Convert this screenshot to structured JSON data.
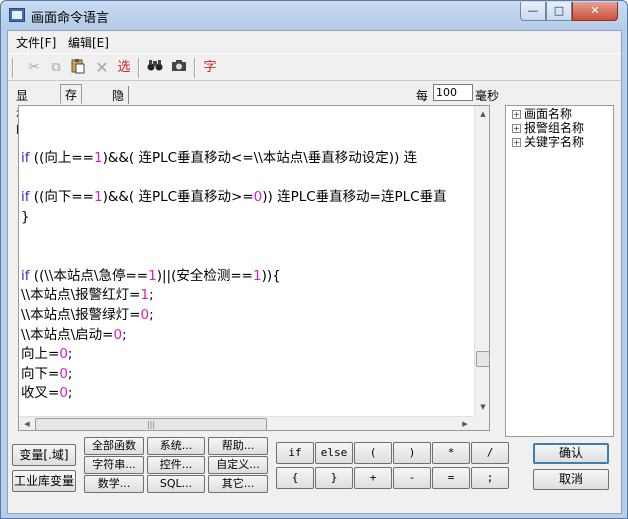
{
  "window": {
    "title": "画面命令语言",
    "min": "—",
    "max": "□",
    "close": "✕"
  },
  "menu": [
    "文件[F]",
    "编辑[E]"
  ],
  "toolbar": {
    "select_label": "选",
    "font_label": "字"
  },
  "tabs": [
    "显示时",
    "存在时",
    "隐含时"
  ],
  "period": {
    "prefix": "每",
    "value": "100",
    "unit": "毫秒"
  },
  "code_lines": [
    {
      "segs": [
        {
          "t": ""
        }
      ]
    },
    {
      "segs": [
        {
          "t": ""
        }
      ]
    },
    {
      "segs": [
        {
          "t": "if",
          "c": "kw"
        },
        {
          "t": " ((向上=="
        },
        {
          "t": "1",
          "c": "num"
        },
        {
          "t": ")&&( 连PLC垂直移动<=\\\\本站点\\垂直移动设定)) 连"
        }
      ]
    },
    {
      "segs": [
        {
          "t": ""
        }
      ]
    },
    {
      "segs": [
        {
          "t": "if",
          "c": "kw"
        },
        {
          "t": " ((向下=="
        },
        {
          "t": "1",
          "c": "num"
        },
        {
          "t": ")&&( 连PLC垂直移动>="
        },
        {
          "t": "0",
          "c": "num"
        },
        {
          "t": ")) 连PLC垂直移动=连PLC垂直"
        }
      ]
    },
    {
      "segs": [
        {
          "t": "}"
        }
      ]
    },
    {
      "segs": [
        {
          "t": ""
        }
      ]
    },
    {
      "segs": [
        {
          "t": ""
        }
      ]
    },
    {
      "segs": [
        {
          "t": "if",
          "c": "kw"
        },
        {
          "t": " ((\\\\本站点\\急停=="
        },
        {
          "t": "1",
          "c": "num"
        },
        {
          "t": ")||(安全检测=="
        },
        {
          "t": "1",
          "c": "num"
        },
        {
          "t": ")){"
        }
      ]
    },
    {
      "segs": [
        {
          "t": "\\\\本站点\\报警红灯="
        },
        {
          "t": "1",
          "c": "num"
        },
        {
          "t": ";"
        }
      ]
    },
    {
      "segs": [
        {
          "t": "\\\\本站点\\报警绿灯="
        },
        {
          "t": "0",
          "c": "num"
        },
        {
          "t": ";"
        }
      ]
    },
    {
      "segs": [
        {
          "t": "\\\\本站点\\启动="
        },
        {
          "t": "0",
          "c": "num"
        },
        {
          "t": ";"
        }
      ]
    },
    {
      "segs": [
        {
          "t": "向上="
        },
        {
          "t": "0",
          "c": "num"
        },
        {
          "t": ";"
        }
      ]
    },
    {
      "segs": [
        {
          "t": "向下="
        },
        {
          "t": "0",
          "c": "num"
        },
        {
          "t": ";"
        }
      ]
    },
    {
      "segs": [
        {
          "t": "收叉="
        },
        {
          "t": "0",
          "c": "num"
        },
        {
          "t": ";"
        }
      ]
    }
  ],
  "tree": [
    "画面名称",
    "报警组名称",
    "关键字名称"
  ],
  "var_buttons": [
    "变量[.域]",
    "工业库变量"
  ],
  "func_buttons": [
    [
      "全部函数",
      "系统...",
      "帮助..."
    ],
    [
      "字符串...",
      "控件...",
      "自定义..."
    ],
    [
      "数学...",
      "SQL...",
      "其它..."
    ]
  ],
  "op_buttons": [
    [
      "if",
      "else",
      "(",
      ")",
      "*",
      "/"
    ],
    [
      "{",
      "}",
      "+",
      "-",
      "=",
      ";"
    ]
  ],
  "dialog": {
    "ok": "确认",
    "cancel": "取消"
  }
}
